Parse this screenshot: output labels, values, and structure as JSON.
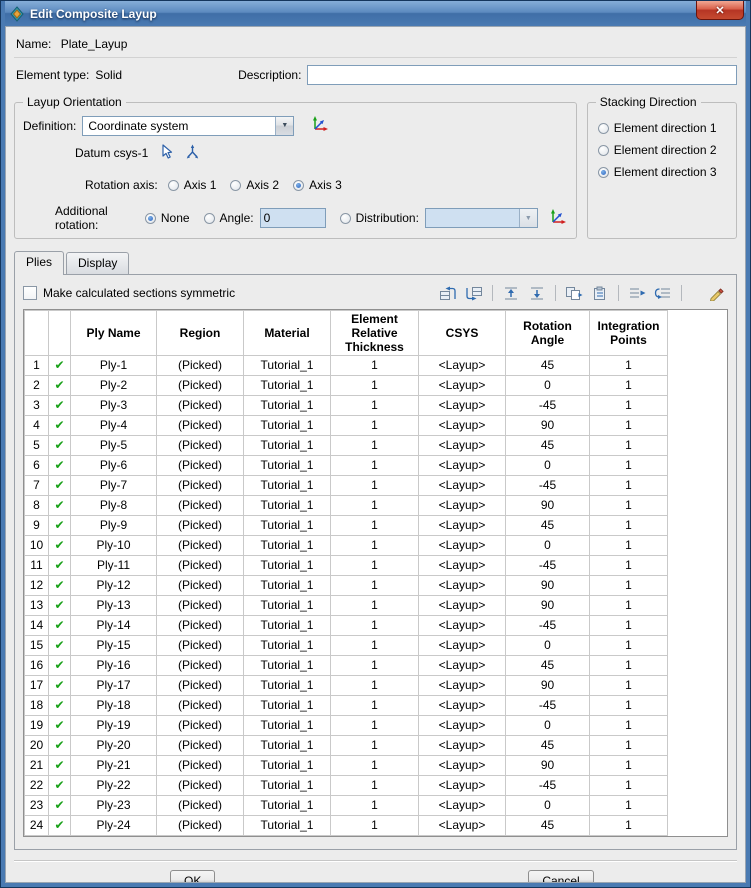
{
  "window": {
    "title": "Edit Composite Layup",
    "close_glyph": "✕"
  },
  "header": {
    "name_label": "Name:",
    "name_value": "Plate_Layup",
    "element_type_label": "Element type:",
    "element_type_value": "Solid",
    "description_label": "Description:",
    "description_value": ""
  },
  "layup_orientation": {
    "legend": "Layup Orientation",
    "definition_label": "Definition:",
    "definition_value": "Coordinate system",
    "datum_label": "Datum csys-1",
    "rotation_axis_label": "Rotation axis:",
    "axis_options": [
      "Axis 1",
      "Axis 2",
      "Axis 3"
    ],
    "additional_rotation_label": "Additional rotation:",
    "none_label": "None",
    "angle_label": "Angle:",
    "angle_value": "0",
    "distribution_label": "Distribution:",
    "distribution_value": ""
  },
  "stacking_direction": {
    "legend": "Stacking Direction",
    "options": [
      "Element direction 1",
      "Element direction 2",
      "Element direction 3"
    ]
  },
  "tabs": {
    "items": [
      "Plies",
      "Display"
    ]
  },
  "selection": {
    "rotation_axis": 2,
    "additional_rotation": 0,
    "stacking_direction": 2,
    "active_tab": 0,
    "make_symmetric": false
  },
  "plies": {
    "symmetric_label": "Make calculated sections symmetric",
    "checkmark": "✔",
    "toolbar_icons": [
      "insert-ply-before",
      "insert-ply-after",
      "move-ply-up",
      "move-ply-down",
      "copy-plies",
      "paste-plies",
      "read-plies-from-file",
      "write-plies-to-file",
      "edit-pattern"
    ],
    "columns": [
      "Ply Name",
      "Region",
      "Material",
      "Element\nRelative\nThickness",
      "CSYS",
      "Rotation\nAngle",
      "Integration\nPoints"
    ],
    "row_fields": [
      "num",
      "name",
      "region",
      "material",
      "thickness",
      "csys",
      "angle",
      "points"
    ],
    "rows": [
      [
        "1",
        "Ply-1",
        "(Picked)",
        "Tutorial_1",
        "1",
        "<Layup>",
        "45",
        "1"
      ],
      [
        "2",
        "Ply-2",
        "(Picked)",
        "Tutorial_1",
        "1",
        "<Layup>",
        "0",
        "1"
      ],
      [
        "3",
        "Ply-3",
        "(Picked)",
        "Tutorial_1",
        "1",
        "<Layup>",
        "-45",
        "1"
      ],
      [
        "4",
        "Ply-4",
        "(Picked)",
        "Tutorial_1",
        "1",
        "<Layup>",
        "90",
        "1"
      ],
      [
        "5",
        "Ply-5",
        "(Picked)",
        "Tutorial_1",
        "1",
        "<Layup>",
        "45",
        "1"
      ],
      [
        "6",
        "Ply-6",
        "(Picked)",
        "Tutorial_1",
        "1",
        "<Layup>",
        "0",
        "1"
      ],
      [
        "7",
        "Ply-7",
        "(Picked)",
        "Tutorial_1",
        "1",
        "<Layup>",
        "-45",
        "1"
      ],
      [
        "8",
        "Ply-8",
        "(Picked)",
        "Tutorial_1",
        "1",
        "<Layup>",
        "90",
        "1"
      ],
      [
        "9",
        "Ply-9",
        "(Picked)",
        "Tutorial_1",
        "1",
        "<Layup>",
        "45",
        "1"
      ],
      [
        "10",
        "Ply-10",
        "(Picked)",
        "Tutorial_1",
        "1",
        "<Layup>",
        "0",
        "1"
      ],
      [
        "11",
        "Ply-11",
        "(Picked)",
        "Tutorial_1",
        "1",
        "<Layup>",
        "-45",
        "1"
      ],
      [
        "12",
        "Ply-12",
        "(Picked)",
        "Tutorial_1",
        "1",
        "<Layup>",
        "90",
        "1"
      ],
      [
        "13",
        "Ply-13",
        "(Picked)",
        "Tutorial_1",
        "1",
        "<Layup>",
        "90",
        "1"
      ],
      [
        "14",
        "Ply-14",
        "(Picked)",
        "Tutorial_1",
        "1",
        "<Layup>",
        "-45",
        "1"
      ],
      [
        "15",
        "Ply-15",
        "(Picked)",
        "Tutorial_1",
        "1",
        "<Layup>",
        "0",
        "1"
      ],
      [
        "16",
        "Ply-16",
        "(Picked)",
        "Tutorial_1",
        "1",
        "<Layup>",
        "45",
        "1"
      ],
      [
        "17",
        "Ply-17",
        "(Picked)",
        "Tutorial_1",
        "1",
        "<Layup>",
        "90",
        "1"
      ],
      [
        "18",
        "Ply-18",
        "(Picked)",
        "Tutorial_1",
        "1",
        "<Layup>",
        "-45",
        "1"
      ],
      [
        "19",
        "Ply-19",
        "(Picked)",
        "Tutorial_1",
        "1",
        "<Layup>",
        "0",
        "1"
      ],
      [
        "20",
        "Ply-20",
        "(Picked)",
        "Tutorial_1",
        "1",
        "<Layup>",
        "45",
        "1"
      ],
      [
        "21",
        "Ply-21",
        "(Picked)",
        "Tutorial_1",
        "1",
        "<Layup>",
        "90",
        "1"
      ],
      [
        "22",
        "Ply-22",
        "(Picked)",
        "Tutorial_1",
        "1",
        "<Layup>",
        "-45",
        "1"
      ],
      [
        "23",
        "Ply-23",
        "(Picked)",
        "Tutorial_1",
        "1",
        "<Layup>",
        "0",
        "1"
      ],
      [
        "24",
        "Ply-24",
        "(Picked)",
        "Tutorial_1",
        "1",
        "<Layup>",
        "45",
        "1"
      ]
    ]
  },
  "footer": {
    "ok_label": "OK",
    "cancel_label": "Cancel"
  },
  "colors": {
    "titlebar_blue": "#4a7ab2",
    "accent_blue": "#2f6bb0",
    "checkmark_green": "#18a018",
    "disabled_field_blue": "#cfe0f1"
  }
}
